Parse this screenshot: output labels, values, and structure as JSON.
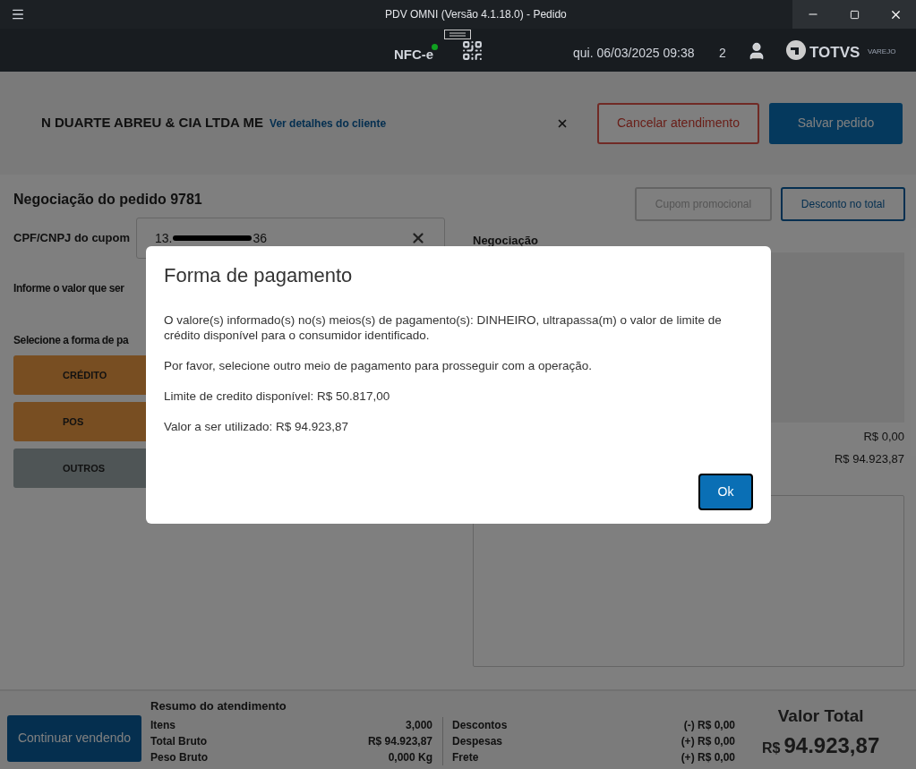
{
  "window": {
    "title": "PDV OMNI (Versão 4.1.18.0) - Pedido"
  },
  "header": {
    "document_type": "NFC-e",
    "connected": true,
    "datetime": "qui. 06/03/2025 09:38",
    "count": "2",
    "logo_text": "TOTVS",
    "logo_subtext": "VAREJO"
  },
  "client": {
    "name": "N DUARTE ABREU & CIA LTDA ME",
    "details_link": "Ver detalhes do cliente"
  },
  "client_actions": [
    {
      "label": "Cancelar atendimento",
      "kind": "outline"
    },
    {
      "label": "Salvar pedido",
      "kind": "primary"
    }
  ],
  "negotiation": {
    "title": "Negociação do pedido 9781",
    "cpf_label": "CPF/CNPJ do cupom",
    "cpf_value_start": "13.",
    "cpf_value_end": "36",
    "amount_prompt": "Informe o valor que ser",
    "payment_prompt": "Selecione a forma de pa",
    "payment_methods": [
      {
        "label": "CRÉDITO",
        "color": "#784e22"
      },
      {
        "label": "POS",
        "color": "#784e22"
      },
      {
        "label": "OUTROS",
        "color": "#4f5556"
      }
    ]
  },
  "order_actions": [
    {
      "label": "Cupom promocional",
      "disabled": true
    },
    {
      "label": "Desconto no total",
      "disabled": false
    }
  ],
  "summary_panel": {
    "label": "Negociação",
    "values": [
      "R$ 0,00",
      "R$ 94.923,87"
    ]
  },
  "dialog": {
    "title": "Forma de pagamento",
    "paragraphs": [
      "O valore(s) informado(s) no(s) meios(s) de pagamento(s): DINHEIRO, ultrapassa(m) o valor de limite de crédito disponível para o consumidor identificado.",
      "Por favor, selecione outro meio de pagamento para prosseguir com a operação.",
      "Limite de credito disponível: R$ 50.817,00",
      "Valor a ser utilizado: R$ 94.923,87"
    ],
    "ok_button": "Ok"
  },
  "footer": {
    "continue_button": "Continuar vendendo",
    "summary_title": "Resumo do atendimento",
    "left_rows": [
      {
        "label": "Itens",
        "value": "3,000"
      },
      {
        "label": "Total Bruto",
        "value": "R$ 94.923,87"
      },
      {
        "label": "Peso Bruto",
        "value": "0,000 Kg"
      }
    ],
    "right_rows": [
      {
        "label": "Descontos",
        "value": "(-) R$ 0,00"
      },
      {
        "label": "Despesas",
        "value": "(+) R$ 0,00"
      },
      {
        "label": "Frete",
        "value": "(+) R$ 0,00"
      }
    ],
    "total_label": "Valor Total",
    "total_currency": "R$",
    "total_value": "94.923,87"
  }
}
